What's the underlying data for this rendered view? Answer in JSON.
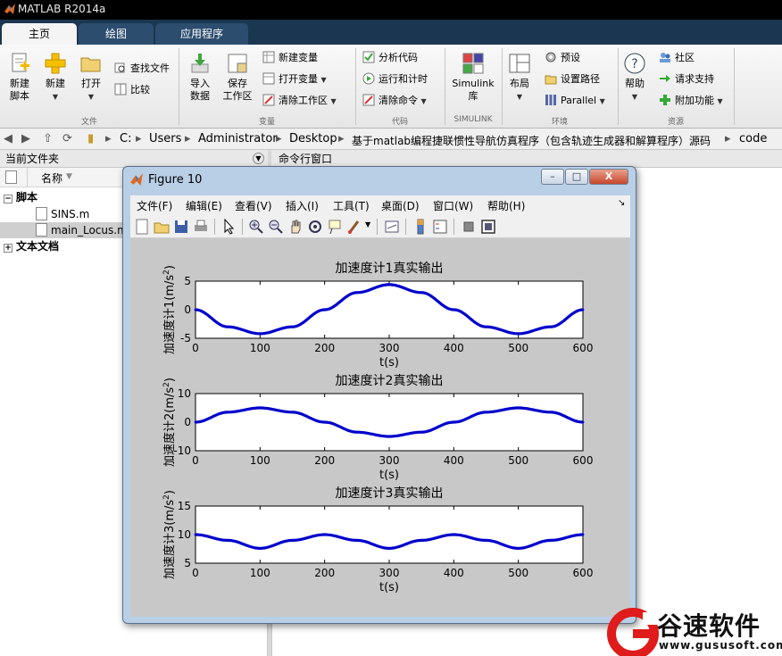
{
  "app": {
    "title": "MATLAB R2014a"
  },
  "tabs": [
    {
      "label": "主页",
      "active": true
    },
    {
      "label": "绘图",
      "active": false
    },
    {
      "label": "应用程序",
      "active": false
    }
  ],
  "ribbon": {
    "file": {
      "new_script": "新建\n脚本",
      "new": "新建",
      "open": "打开",
      "find_files": "查找文件",
      "compare": "比较",
      "group": "文件"
    },
    "variable": {
      "import": "导入\n数据",
      "save_ws": "保存\n工作区",
      "new_var": "新建变量",
      "open_var": "打开变量",
      "clear_ws": "清除工作区",
      "group": "变量"
    },
    "code": {
      "analyze": "分析代码",
      "run_time": "运行和计时",
      "clear_cmd": "清除命令",
      "group": "代码"
    },
    "simulink": {
      "lib": "Simulink\n库",
      "group": "SIMULINK"
    },
    "env": {
      "layout": "布局",
      "prefs": "预设",
      "set_path": "设置路径",
      "parallel": "Parallel",
      "group": "环境"
    },
    "resources": {
      "help": "帮助",
      "community": "社区",
      "request": "请求支持",
      "addons": "附加功能",
      "group": "资源"
    }
  },
  "address": {
    "crumbs": [
      "C:",
      "Users",
      "Administrator",
      "Desktop",
      "基于matlab编程捷联惯性导航仿真程序（包含轨迹生成器和解算程序）源码",
      "code"
    ]
  },
  "current_folder": {
    "title": "当前文件夹",
    "col_name": "名称",
    "sections": [
      "脚本",
      "文本文档"
    ],
    "files": [
      "SINS.m",
      "main_Locus.m"
    ]
  },
  "command_window": {
    "title": "命令行窗口"
  },
  "figure": {
    "title": "Figure 10",
    "menu": [
      "文件(F)",
      "编辑(E)",
      "查看(V)",
      "插入(I)",
      "工具(T)",
      "桌面(D)",
      "窗口(W)",
      "帮助(H)"
    ],
    "buttons": {
      "minimize": "–",
      "maximize": "□",
      "close": "X"
    }
  },
  "chart_data": [
    {
      "type": "line",
      "title": "加速度计1真实输出",
      "xlabel": "t(s)",
      "ylabel": "加速度计1(m/s",
      "ylabel_sup": "2",
      "ylabel_end": ")",
      "xlim": [
        0,
        600
      ],
      "ylim": [
        -5,
        5
      ],
      "xticks": [
        0,
        100,
        200,
        300,
        400,
        500,
        600
      ],
      "yticks": [
        -5,
        0,
        5
      ],
      "color": "#0000cc",
      "series": [
        {
          "x": [
            0,
            50,
            100,
            150,
            200,
            250,
            300,
            350,
            400,
            450,
            500,
            550,
            600
          ],
          "y": [
            0,
            -3,
            -4.2,
            -3,
            0,
            3,
            4.4,
            3,
            0,
            -3,
            -4.2,
            -3,
            0
          ]
        }
      ]
    },
    {
      "type": "line",
      "title": "加速度计2真实输出",
      "xlabel": "t(s)",
      "ylabel": "加速度计2(m/s",
      "ylabel_sup": "2",
      "ylabel_end": ")",
      "xlim": [
        0,
        600
      ],
      "ylim": [
        -10,
        10
      ],
      "xticks": [
        0,
        100,
        200,
        300,
        400,
        500,
        600
      ],
      "yticks": [
        -10,
        0,
        10
      ],
      "color": "#0000cc",
      "series": [
        {
          "x": [
            0,
            50,
            100,
            150,
            200,
            250,
            300,
            350,
            400,
            450,
            500,
            550,
            600
          ],
          "y": [
            0,
            3.5,
            5,
            3.5,
            0,
            -3.5,
            -5,
            -3.5,
            0,
            3.5,
            5,
            3.5,
            0
          ]
        }
      ]
    },
    {
      "type": "line",
      "title": "加速度计3真实输出",
      "xlabel": "t(s)",
      "ylabel": "加速度计3(m/s",
      "ylabel_sup": "2",
      "ylabel_end": ")",
      "xlim": [
        0,
        600
      ],
      "ylim": [
        5,
        15
      ],
      "xticks": [
        0,
        100,
        200,
        300,
        400,
        500,
        600
      ],
      "yticks": [
        5,
        10,
        15
      ],
      "color": "#0000cc",
      "series": [
        {
          "x": [
            0,
            50,
            100,
            150,
            200,
            250,
            300,
            350,
            400,
            450,
            500,
            550,
            600
          ],
          "y": [
            10,
            9,
            7.6,
            9,
            10,
            9,
            7.6,
            9,
            10,
            9,
            7.6,
            9,
            10
          ]
        }
      ]
    }
  ],
  "watermark": {
    "name": "谷速软件",
    "url": "www.gususoft.com"
  }
}
